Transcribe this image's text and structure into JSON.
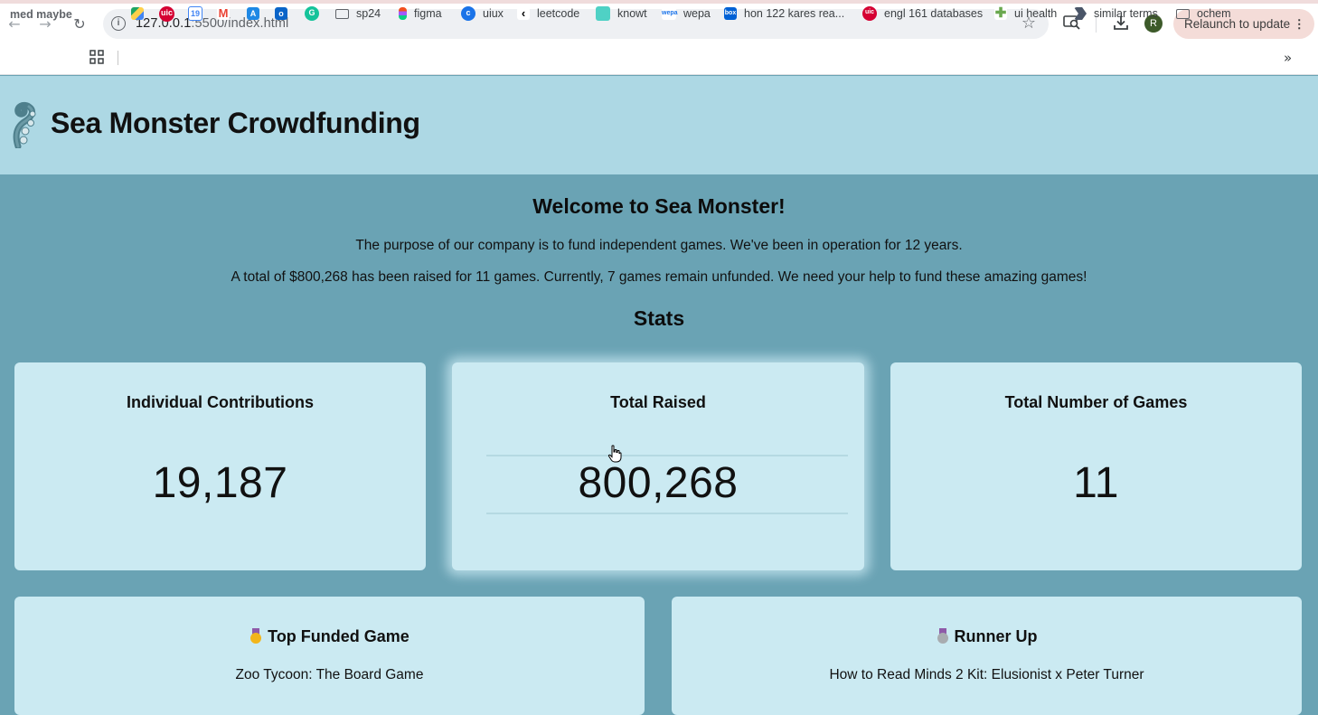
{
  "browser": {
    "url_host": "127.0.0.1",
    "url_path": ":5500/index.html",
    "relaunch_label": "Relaunch to update",
    "avatar_letter": "R",
    "bookmarks": [
      {
        "label": "med maybe"
      },
      {
        "label": "sp24",
        "icon": "folder-icon"
      },
      {
        "label": "figma",
        "icon": "figma-icon"
      },
      {
        "label": "uiux",
        "icon": "uiux-icon"
      },
      {
        "label": "leetcode",
        "icon": "leetcode-icon"
      },
      {
        "label": "knowt",
        "icon": "knowt-icon"
      },
      {
        "label": "wepa",
        "icon": "wepa-icon"
      },
      {
        "label": "hon 122 kares rea...",
        "icon": "box-icon"
      },
      {
        "label": "engl 161 databases",
        "icon": "uic-icon"
      },
      {
        "label": "ui health",
        "icon": "health-icon"
      },
      {
        "label": "similar terms",
        "icon": "arrow-icon"
      },
      {
        "label": "ochem",
        "icon": "folder-icon"
      }
    ],
    "colors": {
      "toolbar": "#ffffff",
      "omnibox": "#eef0f3",
      "relaunch_bg": "#f4dcd8"
    }
  },
  "site": {
    "title": "Sea Monster Crowdfunding",
    "logo_icon": "tentacle-icon"
  },
  "welcome": {
    "heading": "Welcome to Sea Monster!",
    "purpose": "The purpose of our company is to fund independent games. We've been in operation for 12 years.",
    "summary": "A total of $800,268 has been raised for 11 games. Currently, 7 games remain unfunded. We need your help to fund these amazing games!"
  },
  "stats": {
    "heading": "Stats",
    "cards": [
      {
        "title": "Individual Contributions",
        "value": "19,187"
      },
      {
        "title": "Total Raised",
        "value": "800,268"
      },
      {
        "title": "Total Number of Games",
        "value": "11"
      }
    ]
  },
  "highlights": {
    "top": {
      "title": "Top Funded Game",
      "game": "Zoo Tycoon: The Board Game",
      "medal_icon": "gold-medal-icon"
    },
    "runner_up": {
      "title": "Runner Up",
      "game": "How to Read Minds 2 Kit: Elusionist x Peter Turner",
      "medal_icon": "silver-medal-icon"
    }
  },
  "colors": {
    "header_bg": "#add8e4",
    "main_bg": "#6aa3b4",
    "card_bg": "#cbeaf2"
  }
}
